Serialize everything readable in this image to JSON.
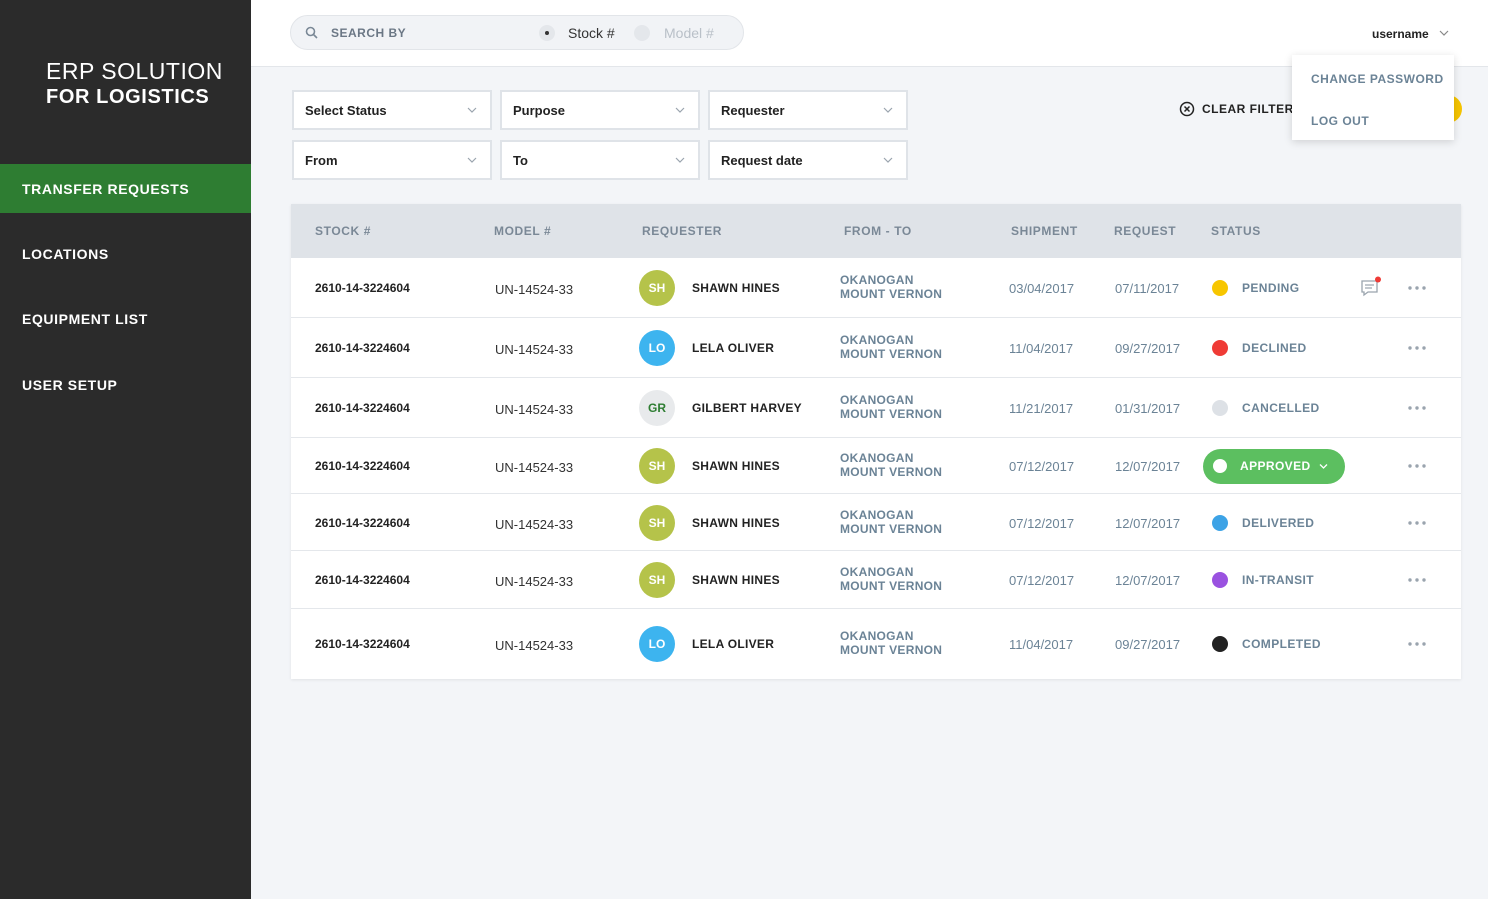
{
  "brand": {
    "line1": "ERP SOLUTION",
    "line2": "FOR LOGISTICS"
  },
  "nav": [
    {
      "label": "TRANSFER REQUESTS",
      "active": true
    },
    {
      "label": "LOCATIONS",
      "active": false
    },
    {
      "label": "EQUIPMENT LIST",
      "active": false
    },
    {
      "label": "USER SETUP",
      "active": false
    }
  ],
  "search": {
    "label": "SEARCH BY",
    "options": [
      "Stock #",
      "Model #"
    ],
    "selected": "Stock #"
  },
  "user": {
    "name": "username",
    "menu": [
      "CHANGE PASSWORD",
      "LOG OUT"
    ]
  },
  "filters": [
    "Select Status",
    "Purpose",
    "Requester",
    "From",
    "To",
    "Request date"
  ],
  "clear_filter": "CLEAR FILTER",
  "table": {
    "columns": [
      "STOCK #",
      "MODEL #",
      "REQUESTER",
      "FROM - TO",
      "SHIPMENT",
      "REQUEST",
      "STATUS"
    ],
    "rows": [
      {
        "stock": "2610-14-3224604",
        "model": "UN-14524-33",
        "initials": "SH",
        "requester": "SHAWN HINES",
        "from": "OKANOGAN",
        "to": "MOUNT VERNON",
        "shipment": "03/04/2017",
        "request": "07/11/2017",
        "status": "PENDING",
        "status_color": "#f7c600"
      },
      {
        "stock": "2610-14-3224604",
        "model": "UN-14524-33",
        "initials": "LO",
        "requester": "LELA OLIVER",
        "from": "OKANOGAN",
        "to": "MOUNT VERNON",
        "shipment": "11/04/2017",
        "request": "09/27/2017",
        "status": "DECLINED",
        "status_color": "#ef3b36"
      },
      {
        "stock": "2610-14-3224604",
        "model": "UN-14524-33",
        "initials": "GR",
        "requester": "GILBERT HARVEY",
        "from": "OKANOGAN",
        "to": "MOUNT VERNON",
        "shipment": "11/21/2017",
        "request": "01/31/2017",
        "status": "CANCELLED",
        "status_color": "#dde1e6"
      },
      {
        "stock": "2610-14-3224604",
        "model": "UN-14524-33",
        "initials": "SH",
        "requester": "SHAWN HINES",
        "from": "OKANOGAN",
        "to": "MOUNT VERNON",
        "shipment": "07/12/2017",
        "request": "12/07/2017",
        "status": "APPROVED",
        "status_color": "#5cbf60"
      },
      {
        "stock": "2610-14-3224604",
        "model": "UN-14524-33",
        "initials": "SH",
        "requester": "SHAWN HINES",
        "from": "OKANOGAN",
        "to": "MOUNT VERNON",
        "shipment": "07/12/2017",
        "request": "12/07/2017",
        "status": "DELIVERED",
        "status_color": "#3da3e6"
      },
      {
        "stock": "2610-14-3224604",
        "model": "UN-14524-33",
        "initials": "SH",
        "requester": "SHAWN HINES",
        "from": "OKANOGAN",
        "to": "MOUNT VERNON",
        "shipment": "07/12/2017",
        "request": "12/07/2017",
        "status": "IN-TRANSIT",
        "status_color": "#9a52e0"
      },
      {
        "stock": "2610-14-3224604",
        "model": "UN-14524-33",
        "initials": "LO",
        "requester": "LELA OLIVER",
        "from": "OKANOGAN",
        "to": "MOUNT VERNON",
        "shipment": "11/04/2017",
        "request": "09/27/2017",
        "status": "COMPLETED",
        "status_color": "#222222"
      }
    ]
  },
  "colors": {
    "sidebar": "#2b2b2b",
    "active_nav": "#2e7d32",
    "accent_yellow": "#f5c400"
  }
}
